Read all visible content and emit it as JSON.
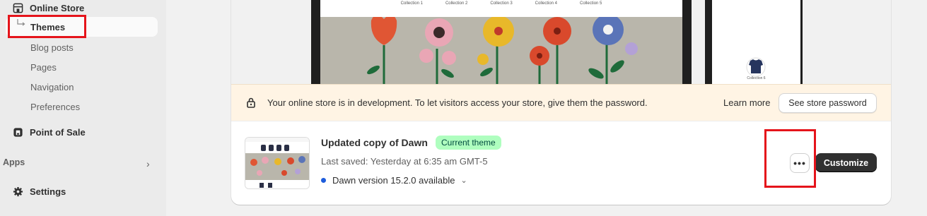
{
  "sidebar": {
    "online_store": "Online Store",
    "themes": "Themes",
    "sub_items": [
      "Blog posts",
      "Pages",
      "Navigation",
      "Preferences"
    ],
    "point_of_sale": "Point of Sale",
    "apps": "Apps",
    "settings": "Settings"
  },
  "preview": {
    "menu": [
      "Collection 1",
      "Collection 2",
      "Collection 3",
      "Collection 4",
      "Collection 5"
    ],
    "mobile_caption": "Collection 6"
  },
  "banner": {
    "text": "Your online store is in development. To let visitors access your store, give them the password.",
    "learn_more": "Learn more",
    "button": "See store password"
  },
  "theme": {
    "name": "Updated copy of Dawn",
    "badge": "Current theme",
    "saved": "Last saved: Yesterday at 6:35 am GMT-5",
    "version": "Dawn version 15.2.0 available",
    "more_label": "•••",
    "customize": "Customize"
  },
  "colors": {
    "accent_dark": "#303030",
    "badge_bg": "#affebf",
    "highlight": "#e5141b",
    "banner_bg": "#fff4e4"
  }
}
